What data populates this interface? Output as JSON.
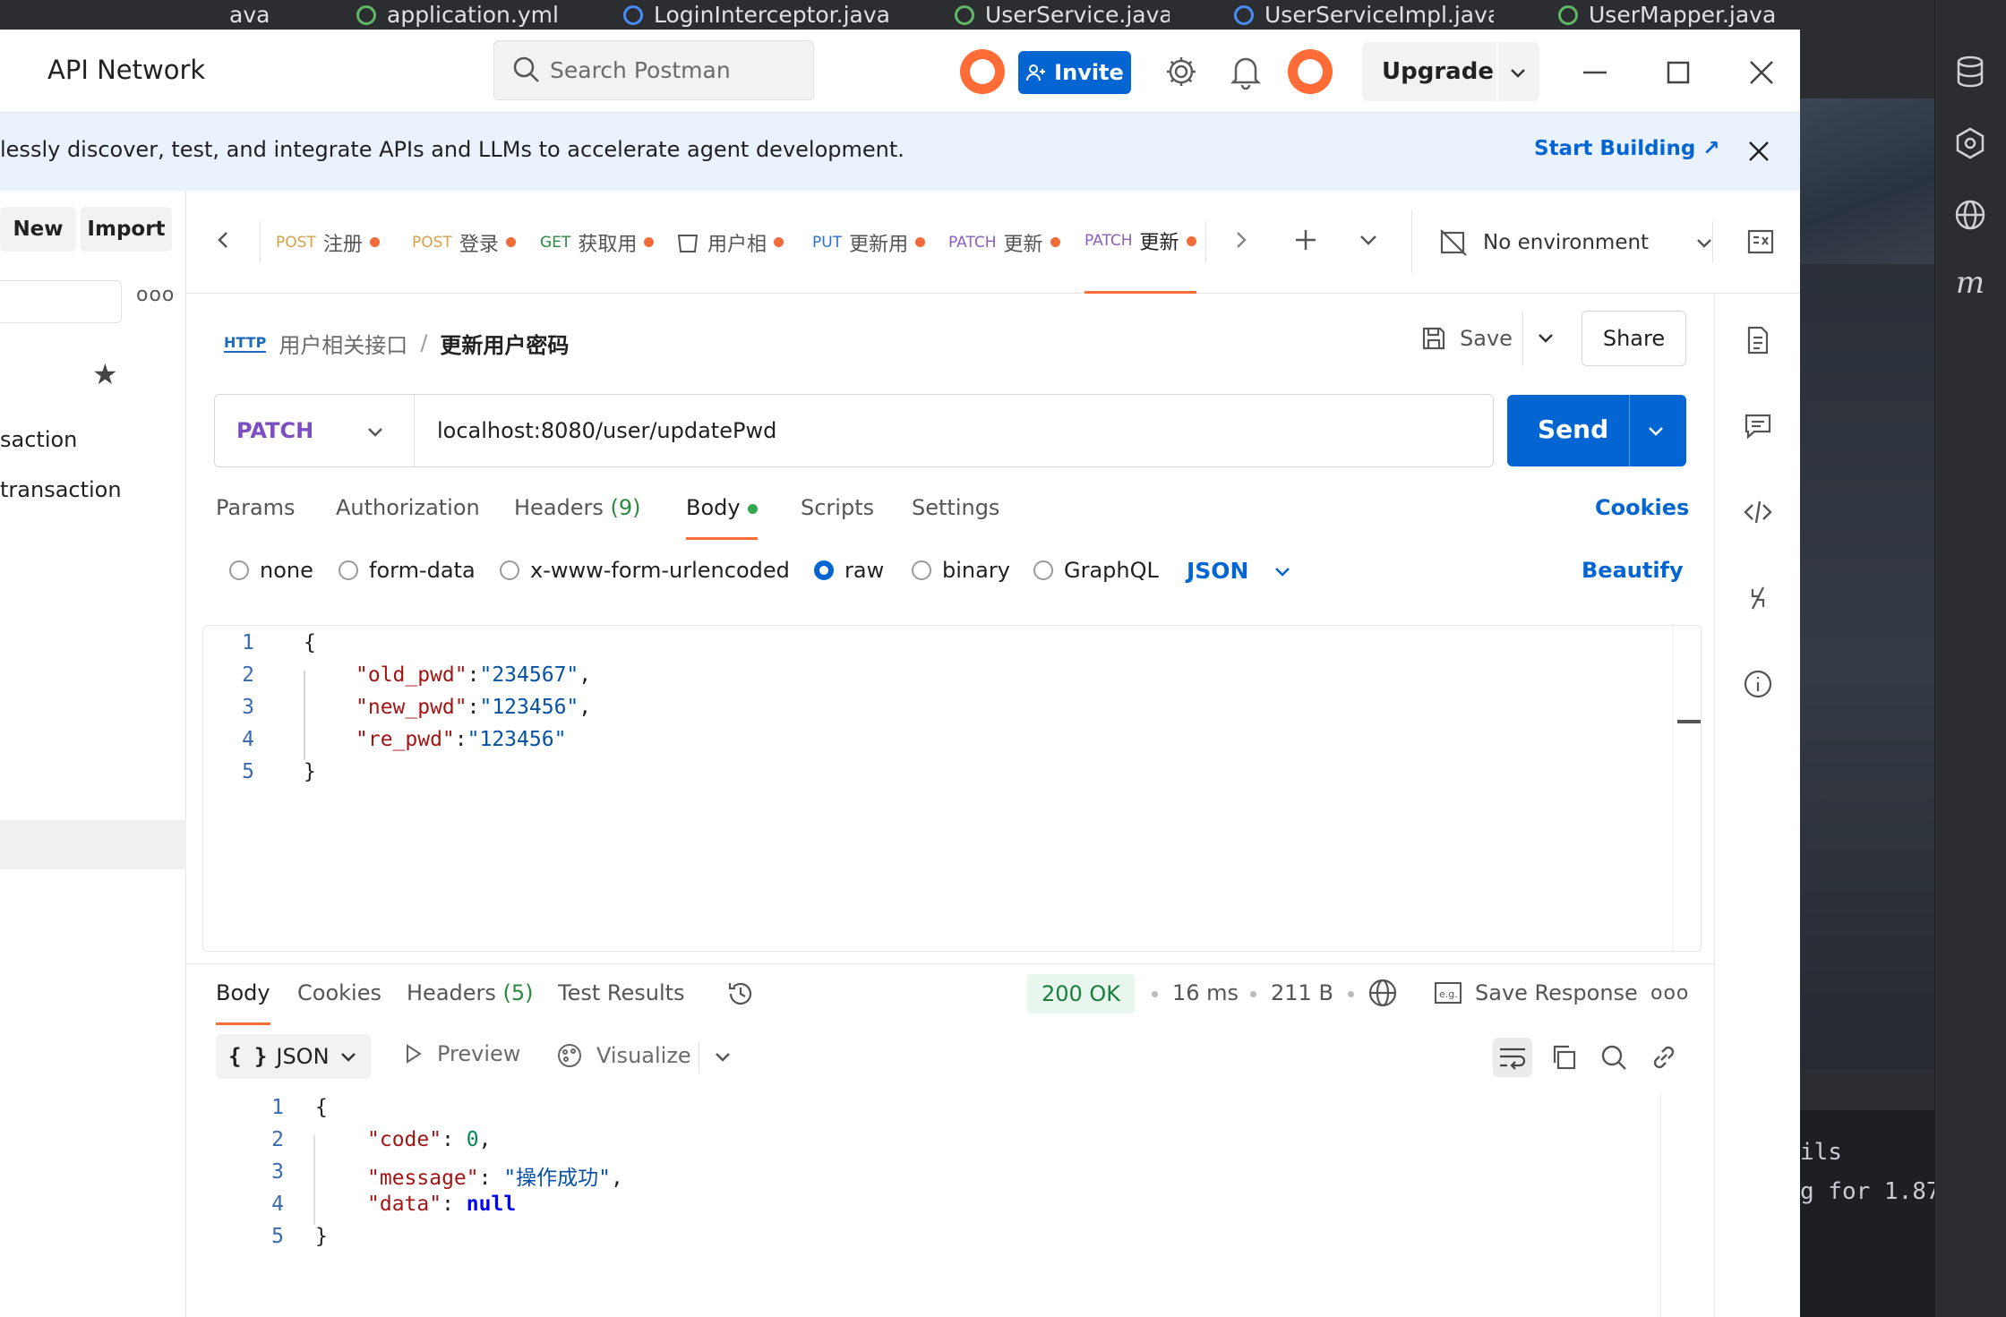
{
  "ide": {
    "tabs": [
      "ava",
      "application.yml",
      "LoginInterceptor.java",
      "UserService.java",
      "UserServiceImpl.java",
      "UserMapper.java"
    ],
    "terminal_lines": [
      "ils",
      "g for 1.87"
    ]
  },
  "titlebar": {
    "workspace": "API Network",
    "search_placeholder": "Search Postman",
    "invite_label": "Invite",
    "upgrade_label": "Upgrade"
  },
  "banner": {
    "text": "lessly discover, test, and integrate APIs and LLMs to accelerate agent development.",
    "cta": "Start Building ↗"
  },
  "sidebar": {
    "new_label": "New",
    "import_label": "Import",
    "items": [
      "saction",
      "transaction"
    ]
  },
  "tabs": [
    {
      "method": "POST",
      "name": "注册",
      "class": "m-post"
    },
    {
      "method": "POST",
      "name": "登录",
      "class": "m-post"
    },
    {
      "method": "GET",
      "name": "获取用",
      "class": "m-get"
    },
    {
      "method": "",
      "name": "用户相",
      "class": ""
    },
    {
      "method": "PUT",
      "name": "更新用",
      "class": "m-put"
    },
    {
      "method": "PATCH",
      "name": "更新",
      "class": "m-patch"
    },
    {
      "method": "PATCH",
      "name": "更新",
      "class": "m-patch"
    }
  ],
  "environment": "No environment",
  "request": {
    "breadcrumb_badge": "HTTP",
    "breadcrumb_parent": "用户相关接口",
    "breadcrumb_sep": "/",
    "breadcrumb_current": "更新用户密码",
    "save_label": "Save",
    "share_label": "Share",
    "method": "PATCH",
    "url": "localhost:8080/user/updatePwd",
    "send_label": "Send",
    "tabs": {
      "params": "Params",
      "authorization": "Authorization",
      "headers": "Headers",
      "headers_count": "(9)",
      "body": "Body",
      "scripts": "Scripts",
      "settings": "Settings"
    },
    "cookies_label": "Cookies",
    "body_types": [
      "none",
      "form-data",
      "x-www-form-urlencoded",
      "raw",
      "binary",
      "GraphQL"
    ],
    "selected_body_type": "raw",
    "format": "JSON",
    "beautify_label": "Beautify",
    "body_lines": [
      {
        "n": "1",
        "punc": "{"
      },
      {
        "n": "2",
        "key": "\"old_pwd\"",
        "colon": ":",
        "val": "\"234567\"",
        "tail": ","
      },
      {
        "n": "3",
        "key": "\"new_pwd\"",
        "colon": ":",
        "val": "\"123456\"",
        "tail": ","
      },
      {
        "n": "4",
        "key": "\"re_pwd\"",
        "colon": ":",
        "val": "\"123456\"",
        "tail": ""
      },
      {
        "n": "5",
        "punc": "}"
      }
    ]
  },
  "response": {
    "tabs": {
      "body": "Body",
      "cookies": "Cookies",
      "headers": "Headers",
      "headers_count": "(5)",
      "test_results": "Test Results"
    },
    "status": "200 OK",
    "time": "16 ms",
    "size": "211 B",
    "save_response_label": "Save Response",
    "format": "JSON",
    "preview_label": "Preview",
    "visualize_label": "Visualize",
    "lines": [
      {
        "n": "1",
        "punc": "{"
      },
      {
        "n": "2",
        "key": "\"code\"",
        "colon": ": ",
        "val": "0",
        "tail": ",",
        "vclass": "n0"
      },
      {
        "n": "3",
        "key": "\"message\"",
        "colon": ": ",
        "val": "\"操作成功\"",
        "tail": ",",
        "vclass": "s"
      },
      {
        "n": "4",
        "key": "\"data\"",
        "colon": ": ",
        "val": "null",
        "tail": "",
        "vclass": "nv"
      },
      {
        "n": "5",
        "punc": "}"
      }
    ]
  }
}
